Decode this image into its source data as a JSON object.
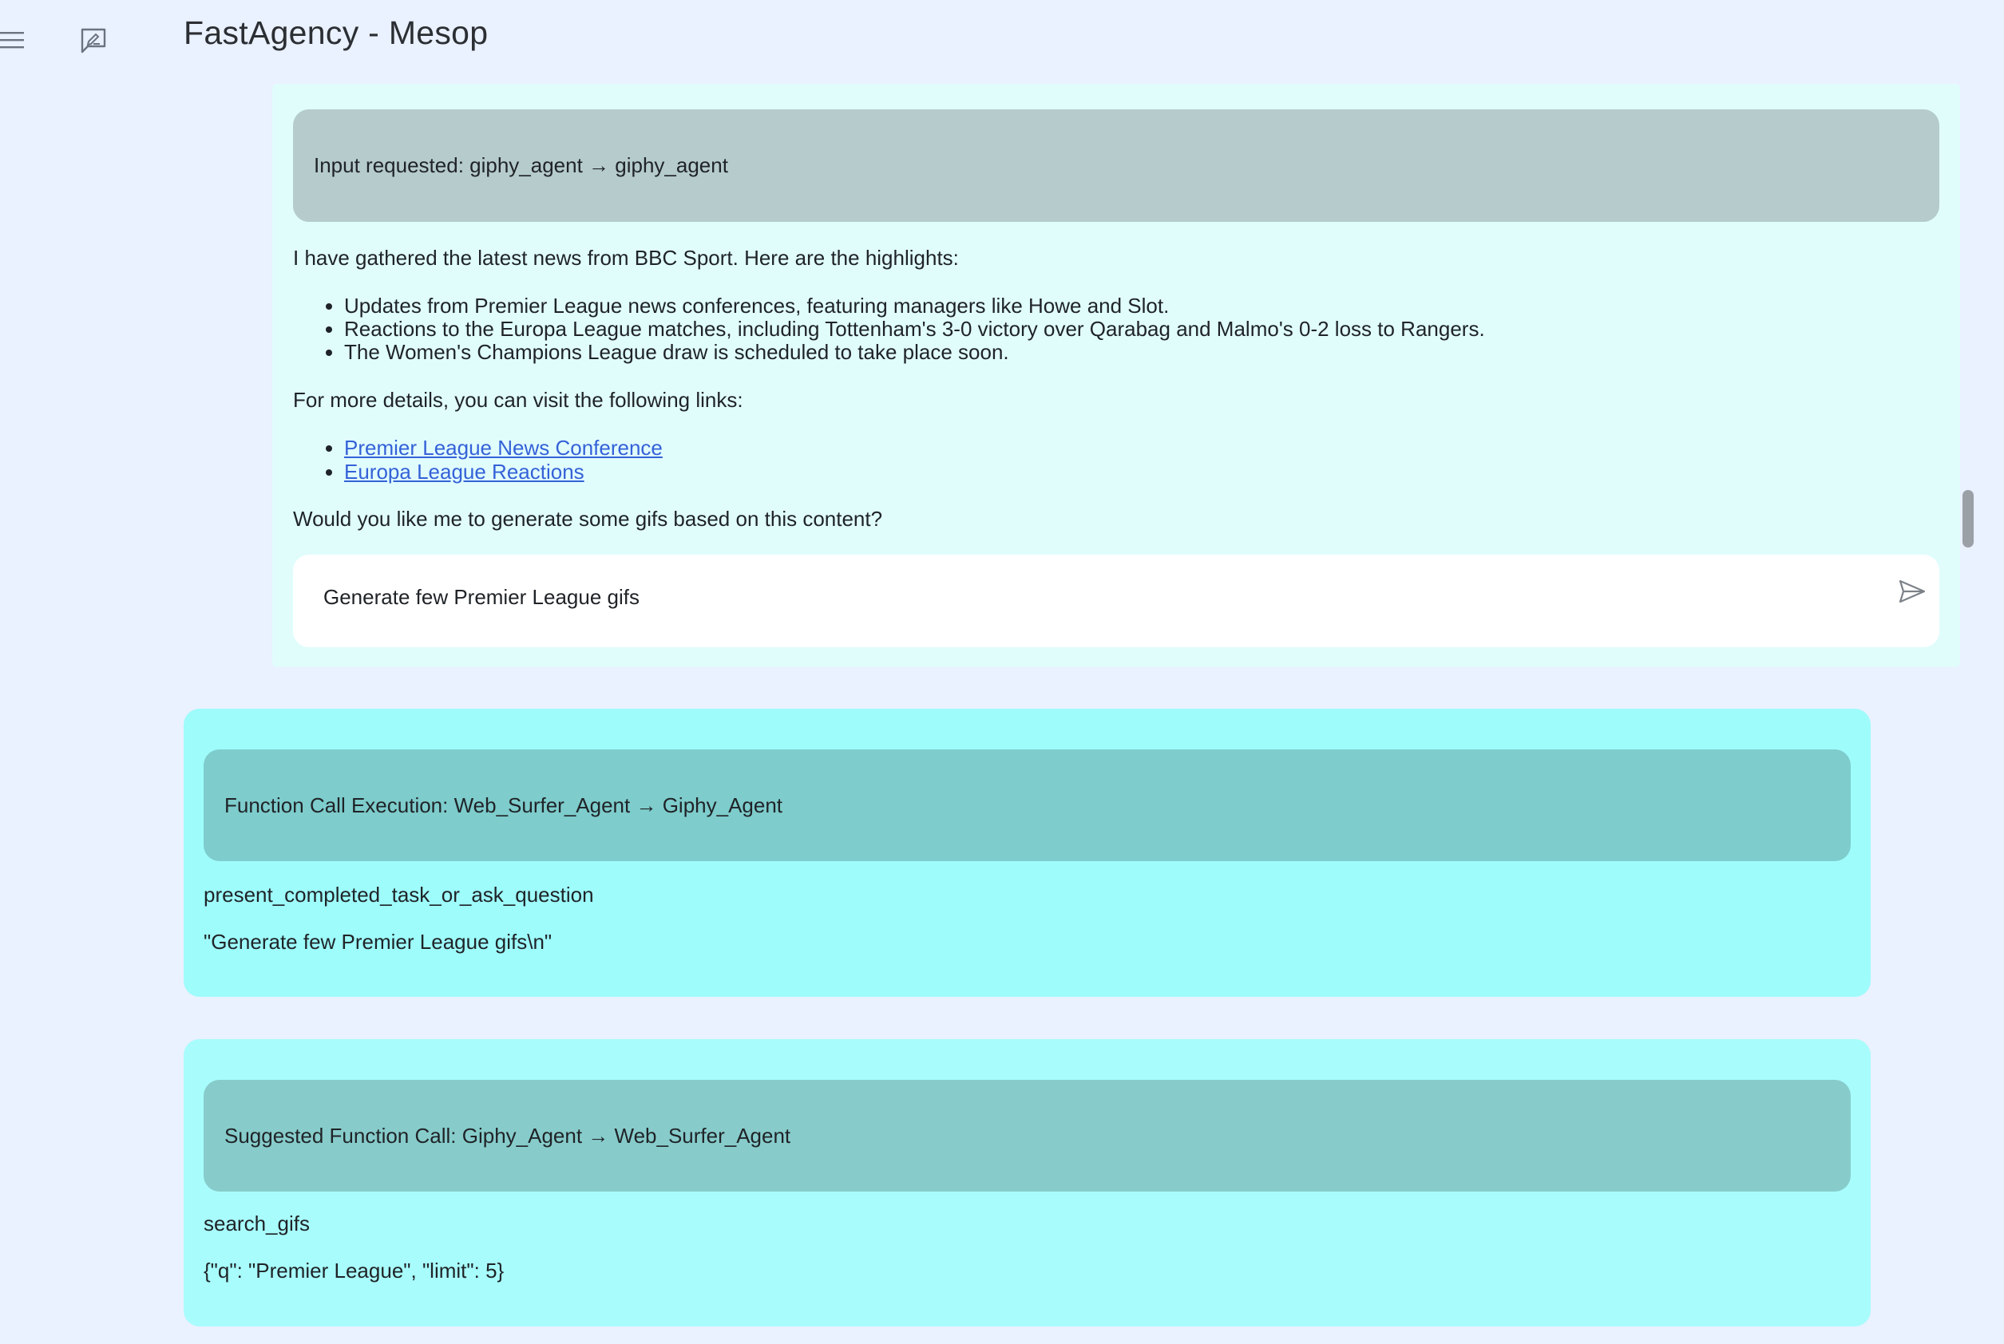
{
  "app": {
    "title": "FastAgency - Mesop",
    "icons": {
      "menu": "hamburger-menu-icon",
      "chat": "chat-bubble-edit-icon",
      "send": "send-arrow-icon"
    }
  },
  "input_request": {
    "header": "Input requested: giphy_agent → giphy_agent",
    "intro": "I have gathered the latest news from BBC Sport. Here are the highlights:",
    "highlights": [
      "Updates from Premier League news conferences, featuring managers like Howe and Slot.",
      "Reactions to the Europa League matches, including Tottenham's 3-0 victory over Qarabag and Malmo's 0-2 loss to Rangers.",
      "The Women's Champions League draw is scheduled to take place soon."
    ],
    "links_intro": "For more details, you can visit the following links:",
    "links": [
      "Premier League News Conference",
      "Europa League Reactions"
    ],
    "question": "Would you like me to generate some gifs based on this content?",
    "reply_value": "Generate few Premier League gifs"
  },
  "function_call_execution": {
    "header": "Function Call Execution: Web_Surfer_Agent → Giphy_Agent",
    "function_name": "present_completed_task_or_ask_question",
    "arguments": "\"Generate few Premier League gifs\\n\""
  },
  "suggested_function_call": {
    "header": "Suggested Function Call: Giphy_Agent → Web_Surfer_Agent",
    "function_name": "search_gifs",
    "arguments": "{\"q\": \"Premier League\", \"limit\": 5}"
  },
  "colors": {
    "page_bg": "#eaf1ff",
    "input_card_bg": "#e0fdfc",
    "input_header_bg": "#b6cbcc",
    "fn_exec_bg": "#9efcfb",
    "fn_exec_header_bg": "#7ecccc",
    "fn_suggest_bg": "#a8fcfc",
    "fn_suggest_header_bg": "#87cccb",
    "link": "#3561d8"
  }
}
